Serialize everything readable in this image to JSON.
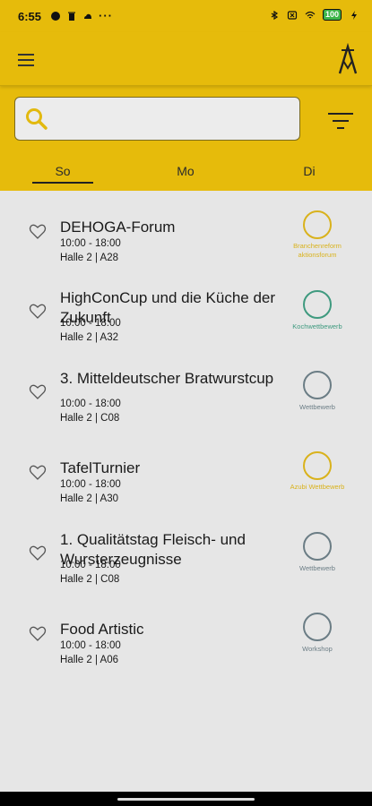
{
  "status_bar": {
    "time": "6:55",
    "battery": "100",
    "left_icons": [
      "circle-icon",
      "trash-icon",
      "cloud-icon",
      "more-dots-icon"
    ],
    "right_icons": [
      "bluetooth-icon",
      "notification-off-icon",
      "wifi-icon",
      "battery-icon",
      "charging-icon"
    ]
  },
  "app_bar": {
    "menu_icon": "hamburger-menu-icon",
    "logo_icon": "brand-logo-icon"
  },
  "search": {
    "value": "",
    "placeholder": ""
  },
  "tabs": [
    {
      "label": "So",
      "active": true
    },
    {
      "label": "Mo",
      "active": false
    },
    {
      "label": "Di",
      "active": false
    }
  ],
  "events": [
    {
      "title": "DEHOGA-Forum",
      "time": "10:00 - 18:00",
      "location": "Halle 2 | A28",
      "category": "Branchenreform aktionsforum",
      "color": "#d9b21c"
    },
    {
      "title": "HighConCup und die Küche der Zukunft",
      "time": "10:00 - 18:00",
      "location": "Halle 2 | A32",
      "category": "Kochwettbewerb",
      "color": "#3f9a7f"
    },
    {
      "title": "3. Mitteldeutscher Bratwurstcup",
      "time": "10:00 - 18:00",
      "location": " Halle 2 | C08",
      "category": "Wettbewerb",
      "color": "#6b7d85"
    },
    {
      "title": "TafelTurnier",
      "time": "10:00 - 18:00",
      "location": "Halle 2 | A30",
      "category": "Azubi Wettbewerb",
      "color": "#d9b21c"
    },
    {
      "title": "1. Qualitätstag Fleisch- und Wursterzeugnisse",
      "time": "10:00 - 18:00",
      "location": "Halle 2 | C08",
      "category": "Wettbewerb",
      "color": "#6b7d85"
    },
    {
      "title": "Food Artistic",
      "time": "10:00 - 18:00",
      "location": "Halle 2 | A06",
      "category": "Workshop",
      "color": "#6b7d85"
    }
  ],
  "colors": {
    "header": "#e6bb0b",
    "background": "#e6e6e6",
    "accent": "#e6bb0b"
  }
}
